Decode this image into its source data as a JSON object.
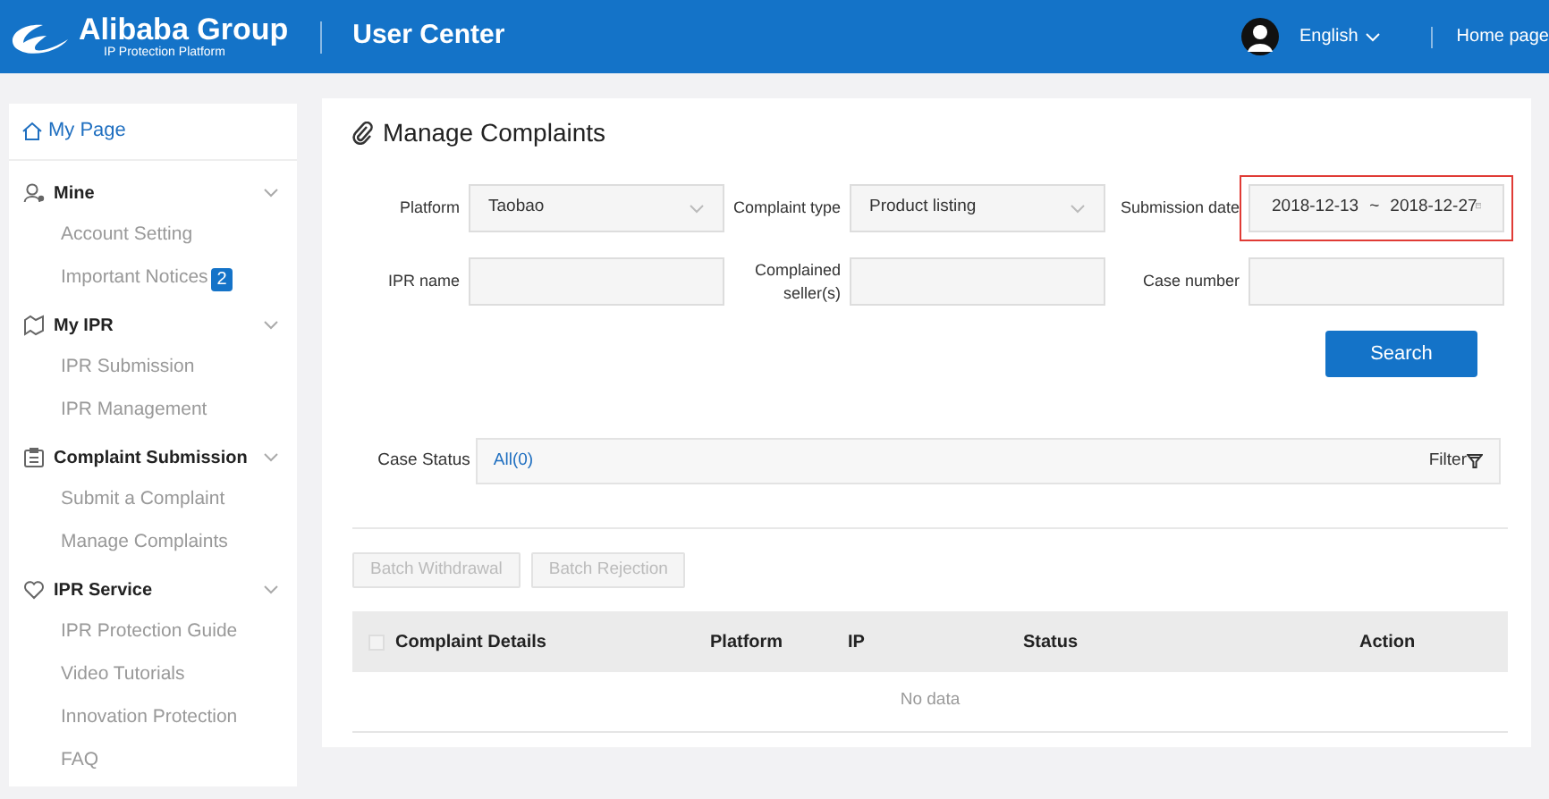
{
  "header": {
    "brand": "Alibaba Group",
    "brand_subtitle": "IP Protection Platform",
    "title": "User Center",
    "language": "English",
    "home_link": "Home page"
  },
  "sidebar": {
    "home": {
      "label": "My Page",
      "selected": true
    },
    "groups": [
      {
        "title": "Mine",
        "kind": "user",
        "expanded": true,
        "items": [
          {
            "label": "Account Setting",
            "selected": false
          },
          {
            "label": "Important Notices",
            "badge": "2",
            "selected": false
          }
        ]
      },
      {
        "title": "My IPR",
        "kind": "map",
        "expanded": true,
        "items": [
          {
            "label": "IPR Submission",
            "selected": false
          },
          {
            "label": "IPR Management",
            "selected": false
          }
        ]
      },
      {
        "title": "Complaint Submission",
        "kind": "clipboard",
        "expanded": true,
        "items": [
          {
            "label": "Submit a Complaint",
            "selected": false
          },
          {
            "label": "Manage Complaints",
            "selected": false
          }
        ]
      },
      {
        "title": "IPR Service",
        "kind": "heart",
        "expanded": true,
        "items": [
          {
            "label": "IPR Protection Guide",
            "selected": false
          },
          {
            "label": "Video Tutorials",
            "selected": false
          },
          {
            "label": "Innovation Protection",
            "selected": false
          },
          {
            "label": "FAQ",
            "selected": false
          }
        ]
      }
    ]
  },
  "page_title": "Manage Complaints",
  "fields": [
    {
      "label": "Platform",
      "kind": "select",
      "value": "Taobao",
      "highlighted": false
    },
    {
      "label": "Complaint type",
      "kind": "select",
      "value": "Product listing",
      "highlighted": false
    },
    {
      "label": "Submission date",
      "kind": "daterange",
      "from": "2018-12-13",
      "separator": "~",
      "to": "2018-12-27",
      "highlighted": true
    },
    {
      "label": "IPR name",
      "kind": "text",
      "highlighted": false
    },
    {
      "label": "Complained seller(s)",
      "kind": "text",
      "highlighted": false
    },
    {
      "label": "Case number",
      "kind": "text",
      "highlighted": false
    }
  ],
  "search_button": "Search",
  "case_status": {
    "label": "Case Status",
    "value": "All(0)",
    "filter": "Filter"
  },
  "batch_buttons": [
    {
      "label": "Batch Withdrawal",
      "disabled": true
    },
    {
      "label": "Batch Rejection",
      "disabled": true
    }
  ],
  "table": {
    "select_all_checked": false,
    "columns": [
      "Complaint Details",
      "Platform",
      "IP",
      "Status",
      "Action"
    ],
    "empty_text": "No data"
  }
}
